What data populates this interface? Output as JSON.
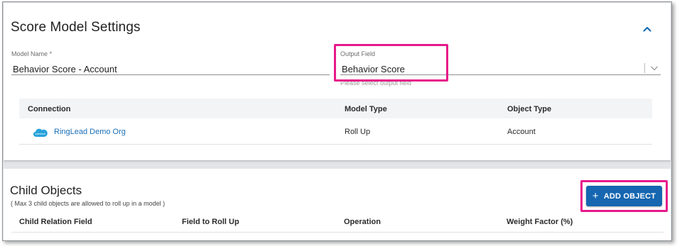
{
  "settings": {
    "title": "Score Model Settings",
    "model_name": {
      "label": "Model Name *",
      "value": "Behavior Score - Account"
    },
    "output_field": {
      "label": "Output Field",
      "value": "Behavior Score",
      "hint": "Please select output field"
    },
    "table": {
      "headers": [
        "Connection",
        "Model Type",
        "Object Type"
      ],
      "rows": [
        {
          "connection": "RingLead Demo Org",
          "connection_icon": "salesforce-cloud-icon",
          "model_type": "Roll Up",
          "object_type": "Account"
        }
      ]
    }
  },
  "child_objects": {
    "title": "Child Objects",
    "subtitle": "( Max 3 child objects are allowed to roll up in a model )",
    "add_button_label": "ADD OBJECT",
    "add_button_icon": "plus-icon",
    "table": {
      "headers": [
        "Child Relation Field",
        "Field to Roll Up",
        "Operation",
        "Weight Factor (%)"
      ]
    }
  },
  "colors": {
    "accent": "#1666b0",
    "link": "#1a6fb7",
    "highlight": "#e6198a",
    "table_header_bg": "#f3f4f6"
  }
}
